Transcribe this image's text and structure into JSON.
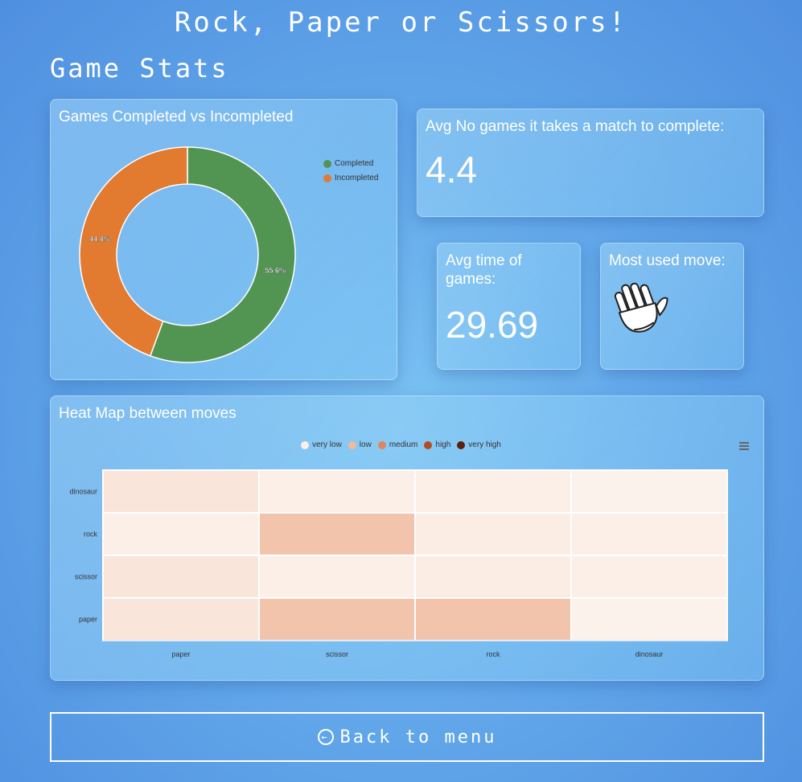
{
  "header": {
    "title": "Rock, Paper or Scissors!",
    "section": "Game Stats"
  },
  "donut_card": {
    "title": "Games Completed vs Incompleted"
  },
  "avg_games_card": {
    "title": "Avg No games it takes a match to complete:",
    "value": "4.4"
  },
  "avg_time_card": {
    "title": "Avg time of games:",
    "value": "29.69"
  },
  "most_used_card": {
    "title": "Most used move:",
    "move_icon": "hand-paper-icon"
  },
  "heatmap_card": {
    "title": "Heat Map between moves"
  },
  "back_button": {
    "label": "Back to menu",
    "icon": "circle-arrow-left-icon"
  },
  "colors": {
    "completed": "#529553",
    "incompleted": "#e27a2f",
    "heat_very_low": "#fcefe9",
    "heat_low": "#f3b99b",
    "heat_medium": "#e0865c",
    "heat_high": "#b24c1f",
    "heat_very_high": "#5e1e0b"
  },
  "chart_data": [
    {
      "type": "pie",
      "title": "Games Completed vs Incompleted",
      "labels": [
        "Completed",
        "Incompleted"
      ],
      "values": [
        55.6,
        44.4
      ],
      "data_labels": [
        "55.6%",
        "44.4%"
      ],
      "colors": [
        "#529553",
        "#e27a2f"
      ],
      "legend": "top-right"
    },
    {
      "type": "heatmap",
      "title": "Heat Map between moves",
      "x_categories": [
        "paper",
        "scissor",
        "rock",
        "dinosaur"
      ],
      "y_categories": [
        "dinosaur",
        "rock",
        "scissor",
        "paper"
      ],
      "legend_entries": [
        "very low",
        "low",
        "medium",
        "high",
        "very high"
      ],
      "legend_colors": [
        "#fcefe9",
        "#f3b99b",
        "#e0865c",
        "#b24c1f",
        "#5e1e0b"
      ],
      "legend": "top-center",
      "values": [
        [
          0.12,
          0.05,
          0.05,
          0.03
        ],
        [
          0.05,
          0.35,
          0.07,
          0.05
        ],
        [
          0.12,
          0.05,
          0.07,
          0.05
        ],
        [
          0.12,
          0.35,
          0.35,
          0.03
        ]
      ],
      "value_range": [
        0,
        1
      ]
    }
  ]
}
